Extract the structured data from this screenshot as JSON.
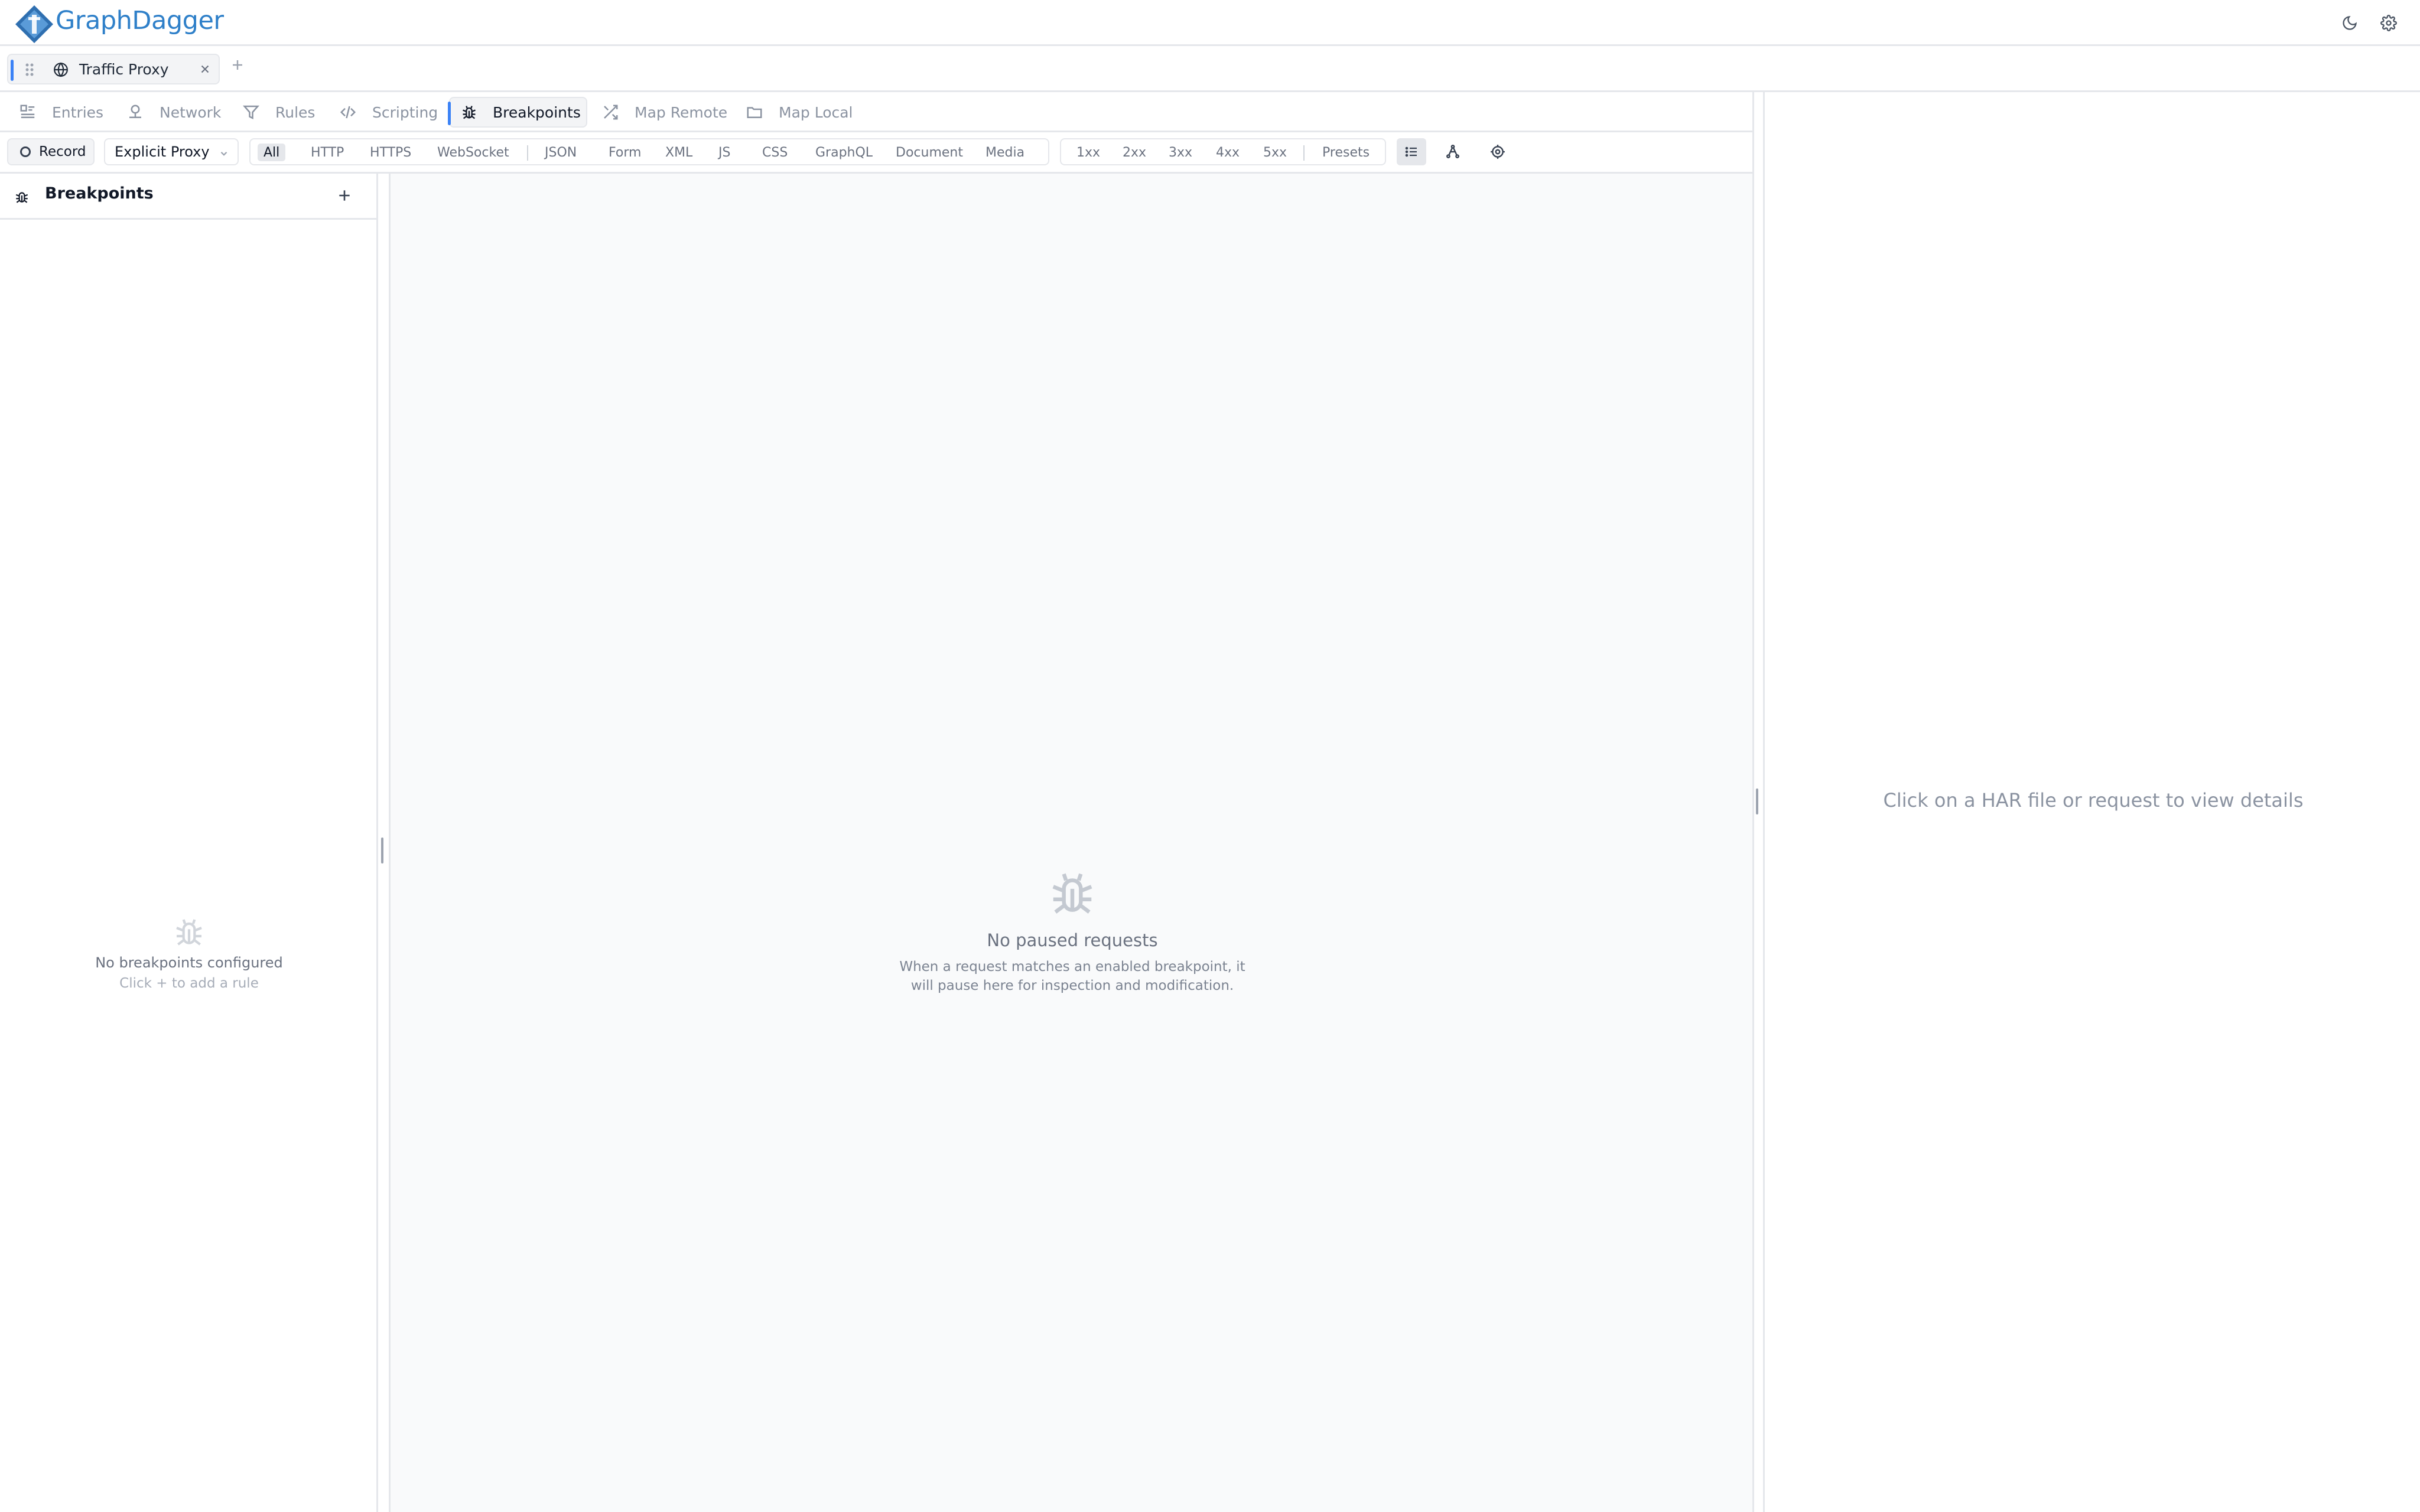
{
  "app": {
    "brand": "GraphDagger",
    "brand_color": "#2f80c9",
    "accent_color": "#3b82f6"
  },
  "header": {
    "icons": [
      "moon-icon",
      "gear-icon"
    ]
  },
  "tabs": {
    "items": [
      {
        "title": "Traffic Proxy",
        "icon": "globe-icon"
      }
    ]
  },
  "nav": {
    "items": [
      {
        "label": "Entries",
        "icon": "entries-icon"
      },
      {
        "label": "Network",
        "icon": "network-icon"
      },
      {
        "label": "Rules",
        "icon": "filter-icon"
      },
      {
        "label": "Scripting",
        "icon": "code-icon"
      },
      {
        "label": "Breakpoints",
        "icon": "bug-icon",
        "active": true
      },
      {
        "label": "Map Remote",
        "icon": "shuffle-icon"
      },
      {
        "label": "Map Local",
        "icon": "folder-icon"
      }
    ]
  },
  "toolbar": {
    "record_label": "Record",
    "mode_value": "Explicit Proxy",
    "type_filters": [
      "All",
      "HTTP",
      "HTTPS",
      "WebSocket",
      "JSON",
      "Form",
      "XML",
      "JS",
      "CSS",
      "GraphQL",
      "Document",
      "Media"
    ],
    "active_type_filter": "All",
    "status_filters": [
      "1xx",
      "2xx",
      "3xx",
      "4xx",
      "5xx"
    ],
    "presets_label": "Presets"
  },
  "sidebar": {
    "title": "Breakpoints",
    "empty_title": "No breakpoints configured",
    "empty_hint": "Click + to add a rule"
  },
  "center": {
    "empty_title": "No paused requests",
    "empty_text": "When a request matches an enabled breakpoint, it will pause here for inspection and modification."
  },
  "detail": {
    "placeholder": "Click on a HAR file or request to view details"
  }
}
